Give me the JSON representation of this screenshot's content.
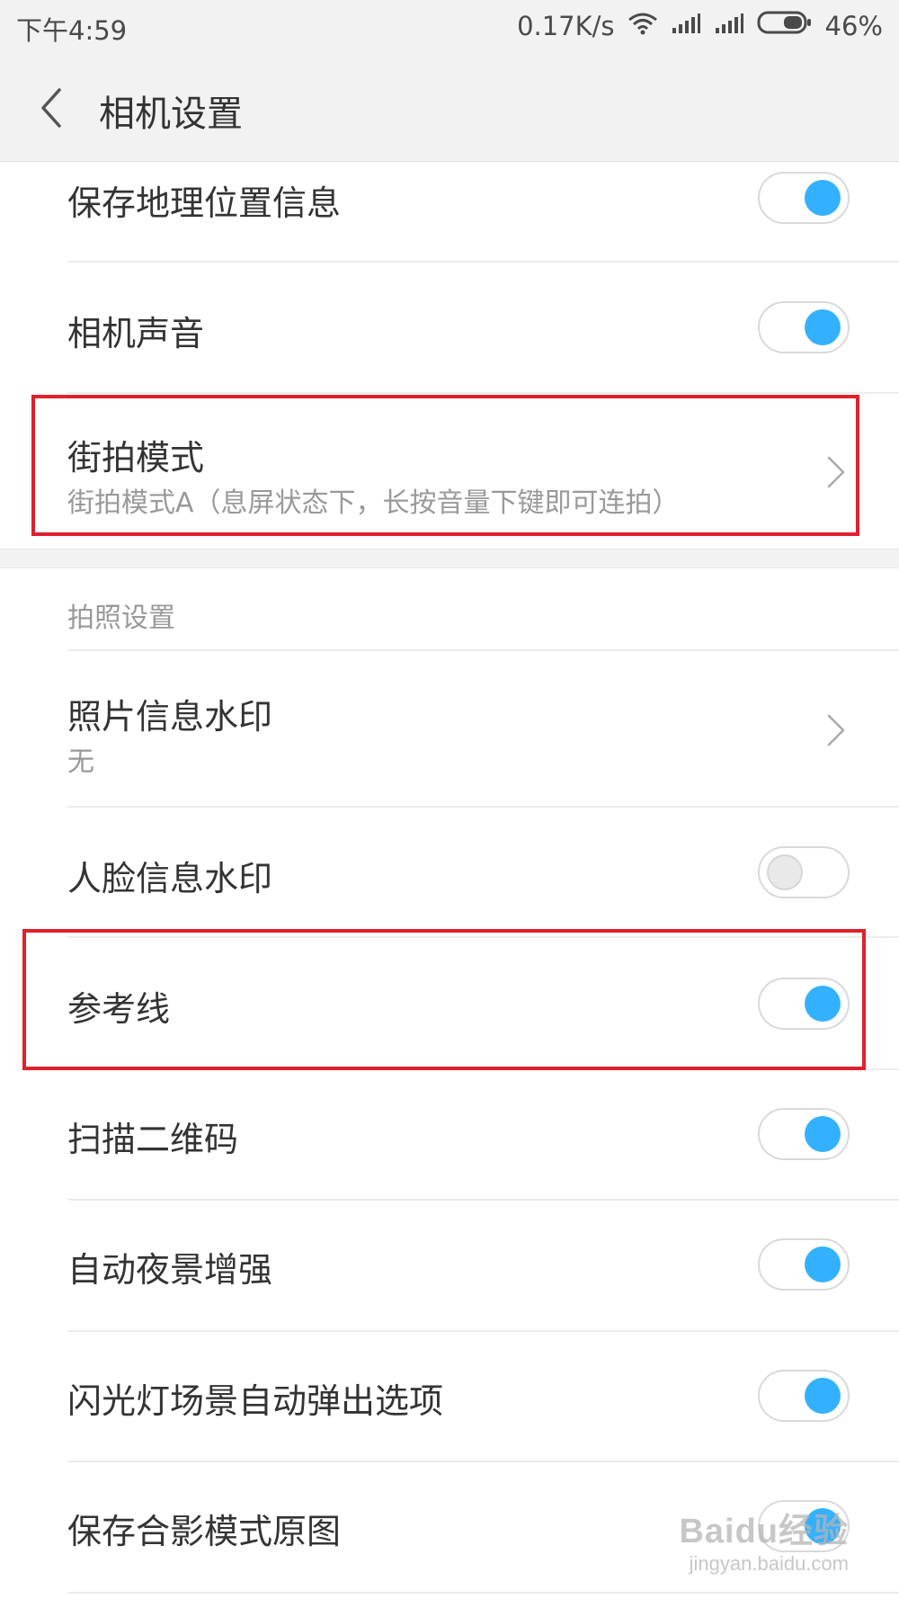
{
  "status_bar": {
    "time": "下午4:59",
    "net_speed": "0.17K/s",
    "battery": "46%",
    "icons": [
      "wifi-icon",
      "signal-icon",
      "signal-icon",
      "battery-icon"
    ]
  },
  "header": {
    "title": "相机设置",
    "back_icon": "chevron-left-icon"
  },
  "settings": {
    "save_location": {
      "label": "保存地理位置信息",
      "enabled": true
    },
    "camera_sound": {
      "label": "相机声音",
      "enabled": true
    },
    "street_mode": {
      "label": "街拍模式",
      "value": "街拍模式A（息屏状态下，长按音量下键即可连拍）"
    },
    "photo_section": {
      "label": "拍照设置"
    },
    "photo_watermark": {
      "label": "照片信息水印",
      "value": "无"
    },
    "face_watermark": {
      "label": "人脸信息水印",
      "enabled": false
    },
    "grid_lines": {
      "label": "参考线",
      "enabled": true
    },
    "scan_qr": {
      "label": "扫描二维码",
      "enabled": true
    },
    "night_enhance": {
      "label": "自动夜景增强",
      "enabled": true
    },
    "flash_popup": {
      "label": "闪光灯场景自动弹出选项",
      "enabled": true
    },
    "save_group_original": {
      "label": "保存合影模式原图",
      "enabled": true
    }
  },
  "watermark": {
    "brand": "Baidu经验",
    "url": "jingyan.baidu.com"
  },
  "colors": {
    "toggle_on": "#33b1ff",
    "highlight": "#e0202c",
    "background": "#f2f2f2"
  }
}
